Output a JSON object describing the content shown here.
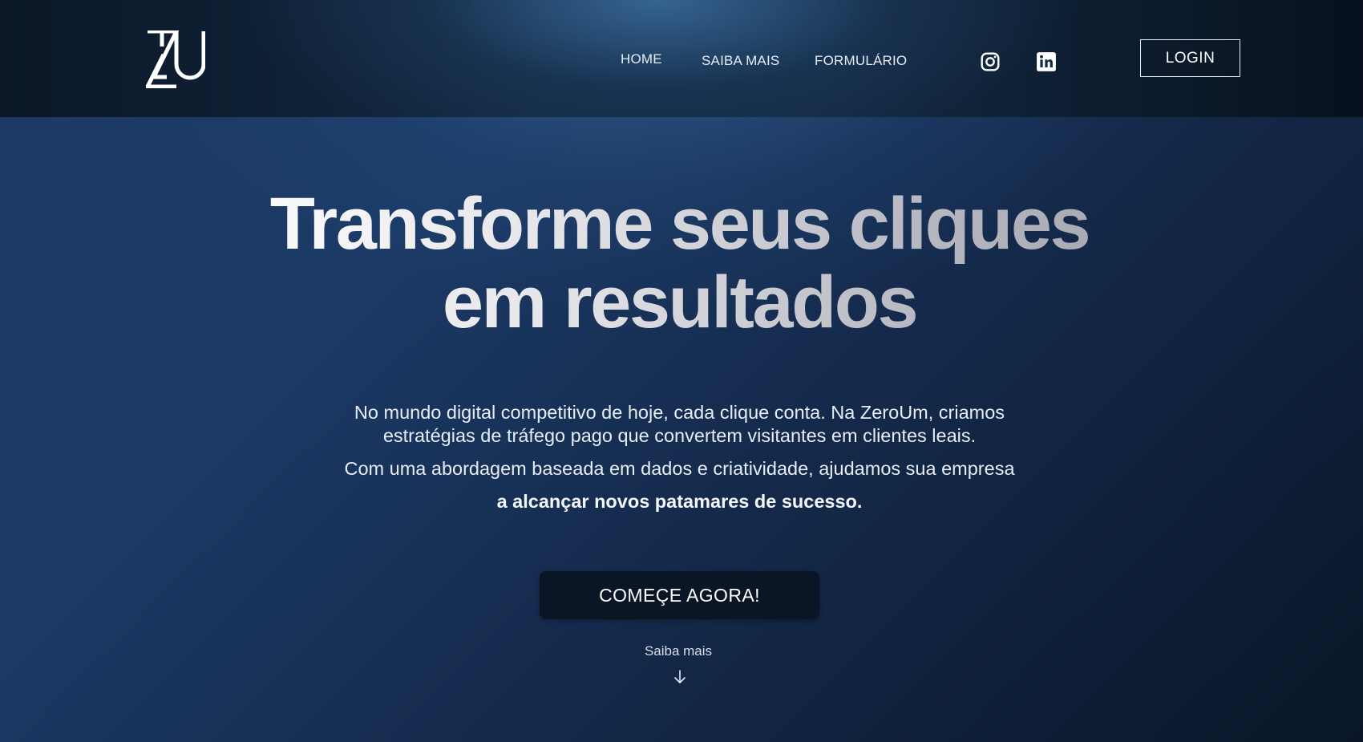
{
  "header": {
    "logo_icon": "zu-logo-icon",
    "nav": [
      {
        "label": "HOME"
      },
      {
        "label": "SAIBA MAIS"
      },
      {
        "label": "FORMULÁRIO"
      }
    ],
    "social": [
      {
        "icon": "instagram-icon"
      },
      {
        "icon": "linkedin-icon"
      }
    ],
    "login_label": "LOGIN"
  },
  "hero": {
    "title_line1": "Transforme seus cliques",
    "title_line2": "em resultados",
    "paragraph_line1": "No mundo digital competitivo de hoje, cada clique conta. Na ZeroUm, criamos",
    "paragraph_line2": "estratégias de tráfego pago que convertem visitantes em clientes leais.",
    "paragraph_line3": "Com uma abordagem baseada em dados e criatividade, ajudamos sua empresa",
    "paragraph_line4": "a alcançar novos patamares de sucesso.",
    "cta_label": "COMEÇE AGORA!",
    "learn_more_label": "Saiba mais",
    "arrow_icon": "arrow-down-icon"
  },
  "colors": {
    "background_dark": "#0a1628",
    "background_blue": "#1c3a62",
    "cta_background": "#0a1626",
    "text": "#ffffff"
  }
}
